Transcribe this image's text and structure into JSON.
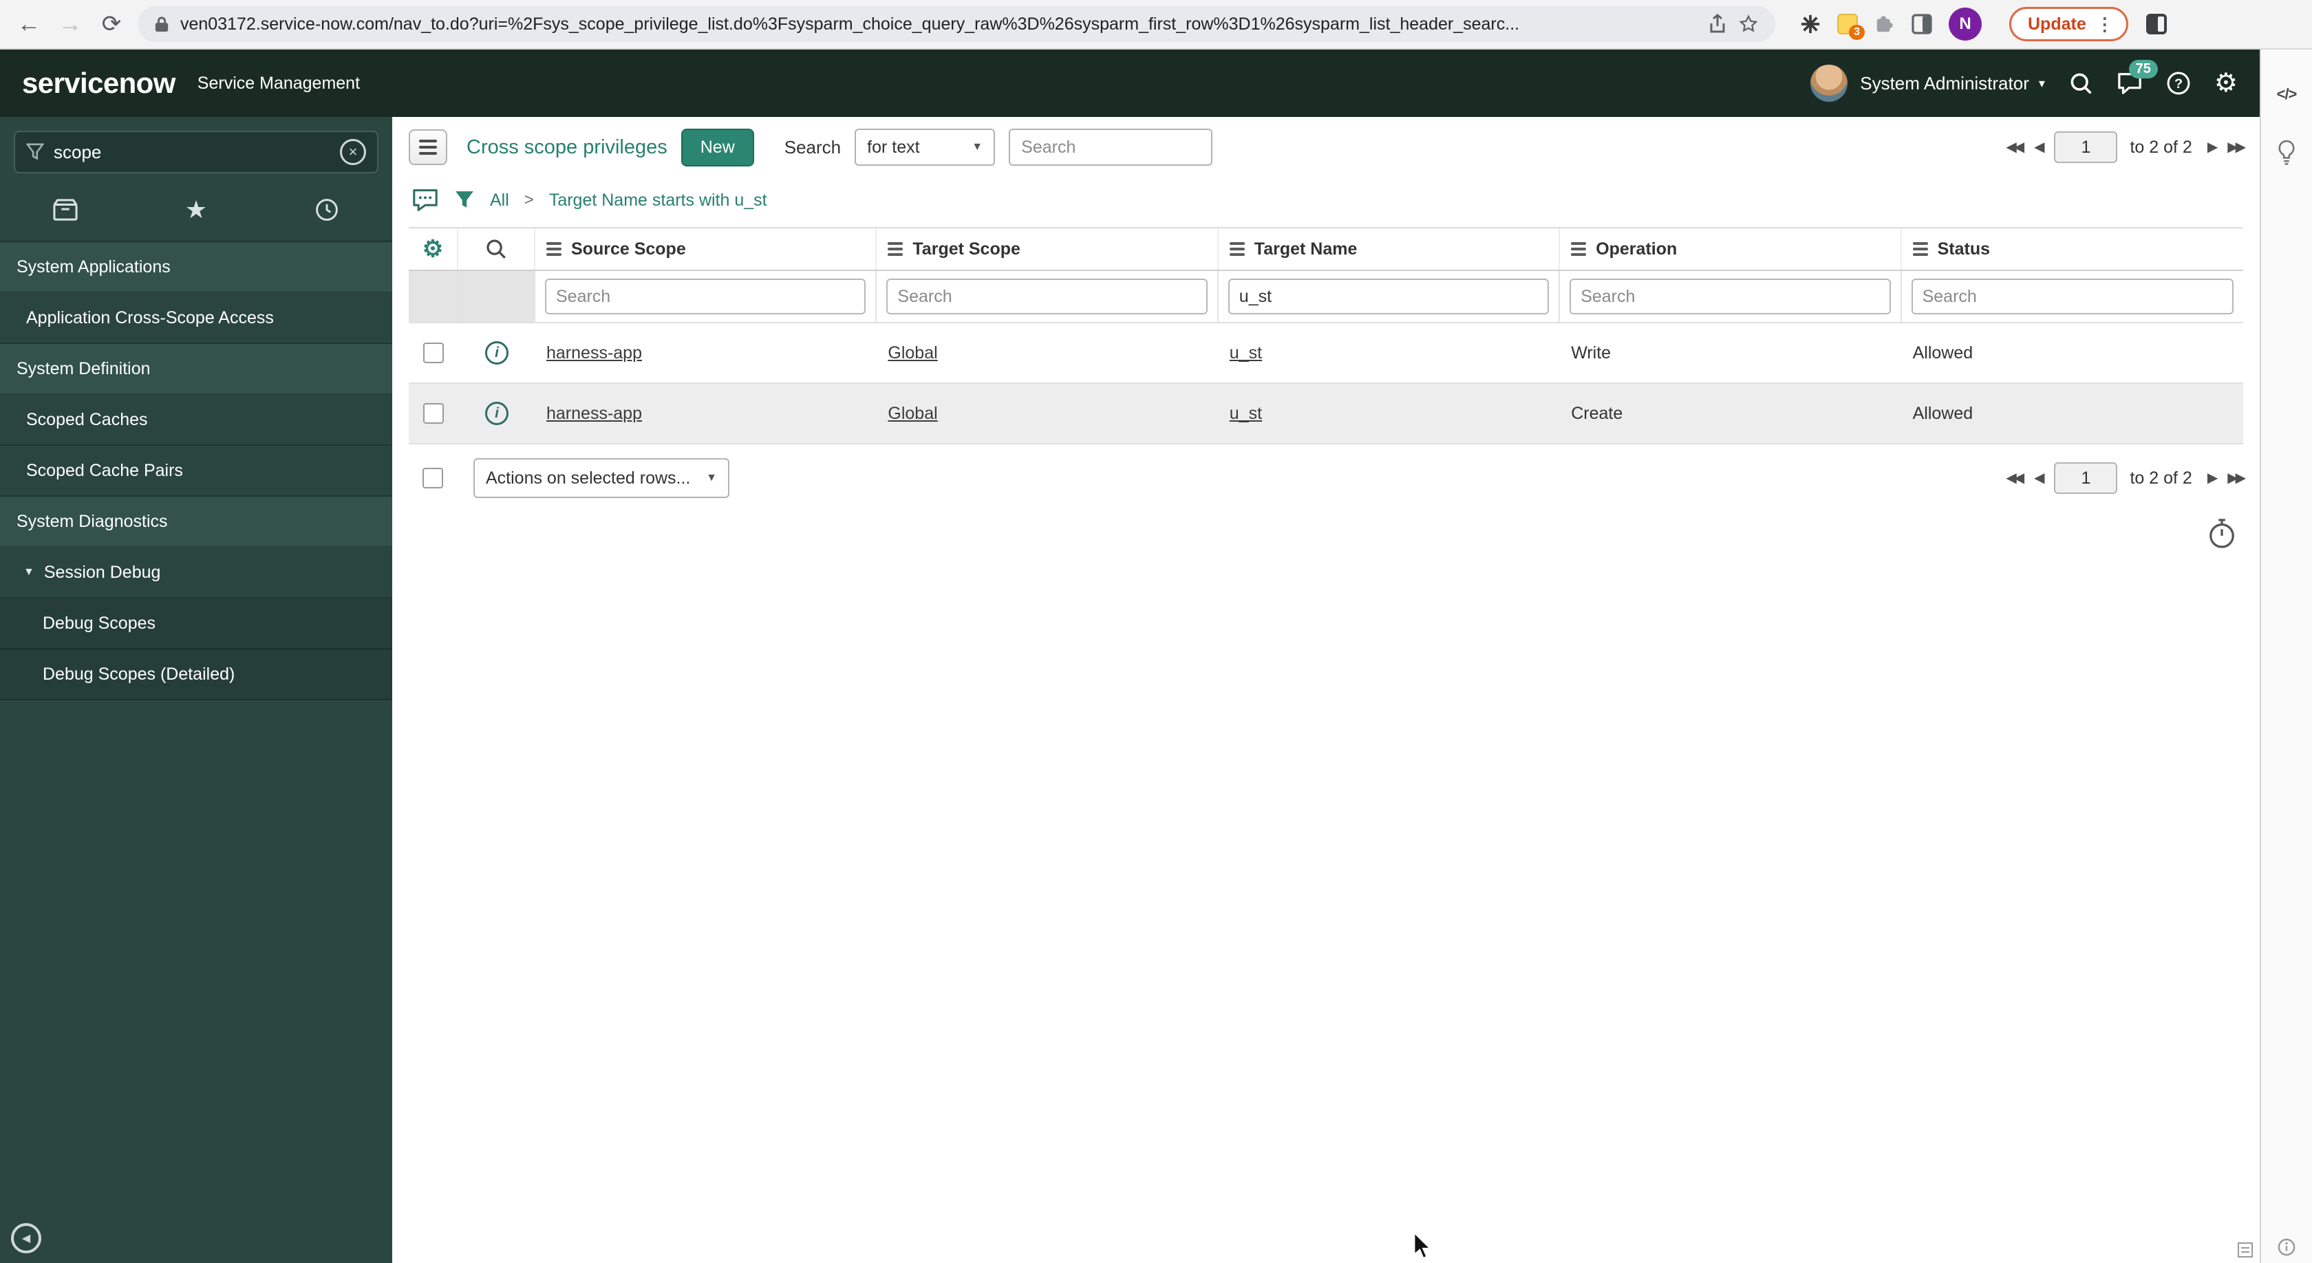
{
  "browser": {
    "url": "ven03172.service-now.com/nav_to.do?uri=%2Fsys_scope_privilege_list.do%3Fsysparm_choice_query_raw%3D%26sysparm_first_row%3D1%26sysparm_list_header_searc...",
    "update_label": "Update",
    "extension_badge_count": "3",
    "profile_initial": "N"
  },
  "app_header": {
    "logo_text": "servicenow",
    "product_name": "Service Management",
    "user_name": "System Administrator",
    "notification_count": "75"
  },
  "sidebar": {
    "filter_value": "scope",
    "items": [
      {
        "label": "System Applications",
        "type": "section"
      },
      {
        "label": "Application Cross-Scope Access",
        "type": "item"
      },
      {
        "label": "System Definition",
        "type": "section"
      },
      {
        "label": "Scoped Caches",
        "type": "item"
      },
      {
        "label": "Scoped Cache Pairs",
        "type": "item"
      },
      {
        "label": "System Diagnostics",
        "type": "section"
      },
      {
        "label": "Session Debug",
        "type": "item-expanded"
      },
      {
        "label": "Debug Scopes",
        "type": "subitem"
      },
      {
        "label": "Debug Scopes (Detailed)",
        "type": "subitem"
      }
    ]
  },
  "toolbar": {
    "title": "Cross scope privileges",
    "new_button_label": "New",
    "search_label": "Search",
    "search_type_value": "for text",
    "search_placeholder": "Search"
  },
  "breadcrumb": {
    "root": "All",
    "separator": ">",
    "current": "Target Name starts with u_st"
  },
  "pagination": {
    "page_value": "1",
    "range_text": "to 2 of 2"
  },
  "list": {
    "columns": [
      "Source Scope",
      "Target Scope",
      "Target Name",
      "Operation",
      "Status"
    ],
    "filter_placeholder": "Search",
    "filters": {
      "source_scope": "",
      "target_scope": "",
      "target_name": "u_st",
      "operation": "",
      "status": ""
    },
    "rows": [
      {
        "source_scope": "harness-app",
        "target_scope": "Global",
        "target_name": "u_st",
        "operation": "Write",
        "status": "Allowed"
      },
      {
        "source_scope": "harness-app",
        "target_scope": "Global",
        "target_name": "u_st",
        "operation": "Create",
        "status": "Allowed"
      }
    ],
    "actions_select_label": "Actions on selected rows..."
  },
  "icons": {
    "back": "←",
    "forward": "→",
    "reload": "⟳",
    "overflow": "⋮",
    "caret_down": "▾",
    "select_caret": "▼",
    "star": "★",
    "gear": "⚙",
    "collapse": "◀",
    "expanded": "▼",
    "clear": "×",
    "pg_first": "◀◀",
    "pg_prev": "◀",
    "pg_next": "▶",
    "pg_last": "▶▶",
    "code": "</>",
    "info": "i"
  },
  "colors": {
    "accent_teal": "#27806d",
    "header_bg": "#1a2b24",
    "sidebar_bg": "#2b463e"
  }
}
